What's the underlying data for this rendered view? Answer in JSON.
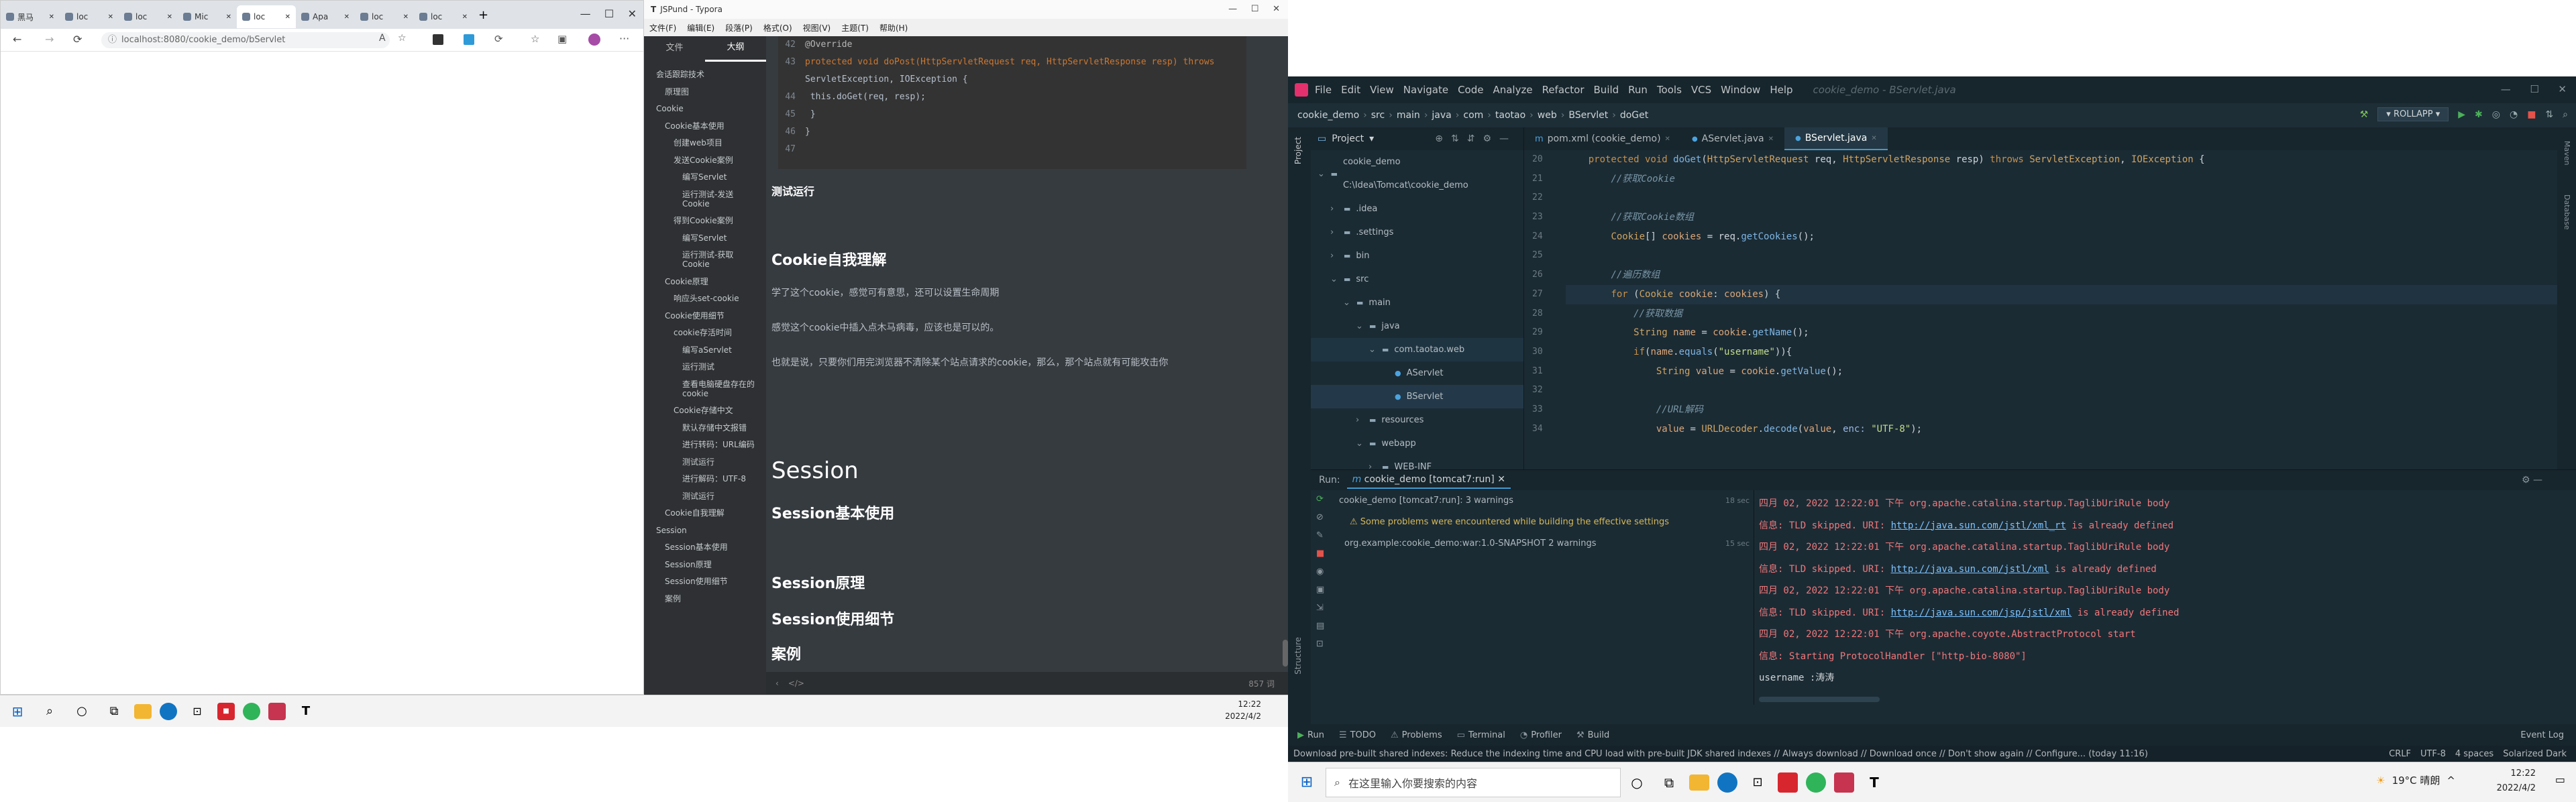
{
  "browser": {
    "tabs": [
      {
        "label": "黑马"
      },
      {
        "label": "loc"
      },
      {
        "label": "loc"
      },
      {
        "label": "Mic"
      },
      {
        "label": "loc"
      },
      {
        "label": "Apa"
      },
      {
        "label": "loc"
      },
      {
        "label": "loc"
      }
    ],
    "url": "localhost:8080/cookie_demo/bServlet"
  },
  "typora": {
    "title": "JSPund - Typora",
    "menu": [
      "文件(F)",
      "编辑(E)",
      "段落(P)",
      "格式(O)",
      "视图(V)",
      "主题(T)",
      "帮助(H)"
    ],
    "side_tabs": [
      "文件",
      "大纲"
    ],
    "outline": [
      {
        "label": "会话跟踪技术",
        "lv": 0
      },
      {
        "label": "原理图",
        "lv": 1
      },
      {
        "label": "Cookie",
        "lv": 0
      },
      {
        "label": "Cookie基本使用",
        "lv": 1
      },
      {
        "label": "创建web项目",
        "lv": 2
      },
      {
        "label": "发送Cookie案例",
        "lv": 2
      },
      {
        "label": "编写Servlet",
        "lv": 3
      },
      {
        "label": "运行测试-发送Cookie",
        "lv": 3
      },
      {
        "label": "得到Cookie案例",
        "lv": 2
      },
      {
        "label": "编写Servlet",
        "lv": 3
      },
      {
        "label": "运行测试-获取Cookie",
        "lv": 3
      },
      {
        "label": "Cookie原理",
        "lv": 1
      },
      {
        "label": "响应头set-cookie",
        "lv": 2
      },
      {
        "label": "Cookie使用细节",
        "lv": 1
      },
      {
        "label": "cookie存活时间",
        "lv": 2
      },
      {
        "label": "编写aServlet",
        "lv": 3
      },
      {
        "label": "运行测试",
        "lv": 3
      },
      {
        "label": "查看电脑硬盘存在的cookie",
        "lv": 3
      },
      {
        "label": "Cookie存储中文",
        "lv": 2
      },
      {
        "label": "默认存储中文报错",
        "lv": 3
      },
      {
        "label": "进行转码：URL编码",
        "lv": 3
      },
      {
        "label": "测试运行",
        "lv": 3
      },
      {
        "label": "进行解码：UTF-8",
        "lv": 3
      },
      {
        "label": "测试运行",
        "lv": 3
      },
      {
        "label": "Cookie自我理解",
        "lv": 1
      },
      {
        "label": "Session",
        "lv": 0
      },
      {
        "label": "Session基本使用",
        "lv": 1
      },
      {
        "label": "Session原理",
        "lv": 1
      },
      {
        "label": "Session使用细节",
        "lv": 1
      },
      {
        "label": "案例",
        "lv": 1
      }
    ],
    "code": {
      "lines": [
        {
          "n": "42",
          "t": "@Override",
          "cls": "an"
        },
        {
          "n": "43",
          "t": "protected void doPost(HttpServletRequest req, HttpServletResponse resp) throws",
          "cls": "kw"
        },
        {
          "n": "",
          "t": "ServletException, IOException {",
          "cls": ""
        },
        {
          "n": "44",
          "t": "    this.doGet(req, resp);",
          "cls": ""
        },
        {
          "n": "45",
          "t": "  }",
          "cls": ""
        },
        {
          "n": "46",
          "t": "}",
          "cls": ""
        },
        {
          "n": "47",
          "t": "",
          "cls": ""
        }
      ]
    },
    "sections": {
      "test_run": "测试运行",
      "cookie_self": "Cookie自我理解",
      "p1": "学了这个cookie，感觉可有意思，还可以设置生命周期",
      "p2": "感觉这个cookie中插入点木马病毒，应该也是可以的。",
      "p3": "也就是说，只要你们用完浏览器不清除某个站点请求的cookie，那么，那个站点就有可能攻击你",
      "session": "Session",
      "s_basic": "Session基本使用",
      "s_principle": "Session原理",
      "s_detail": "Session使用细节",
      "case": "案例"
    },
    "status": {
      "left": "</>",
      "right": "857 词"
    }
  },
  "taskbar_left": {
    "time": "12:22",
    "date": "2022/4/2"
  },
  "idea": {
    "menu": [
      "File",
      "Edit",
      "View",
      "Navigate",
      "Code",
      "Analyze",
      "Refactor",
      "Build",
      "Run",
      "Tools",
      "VCS",
      "Window",
      "Help"
    ],
    "title": "cookie_demo - BServlet.java",
    "breadcrumb": [
      "cookie_demo",
      "src",
      "main",
      "java",
      "com",
      "taotao",
      "web",
      "BServlet",
      "doGet"
    ],
    "run_config": "ROLLAPP",
    "project_label": "Project",
    "tree": [
      {
        "label": "cookie_demo  C:\\Idea\\Tomcat\\cookie_demo",
        "d": 0
      },
      {
        "label": ".idea",
        "d": 1
      },
      {
        "label": ".settings",
        "d": 1
      },
      {
        "label": "bin",
        "d": 1
      },
      {
        "label": "src",
        "d": 1
      },
      {
        "label": "main",
        "d": 2
      },
      {
        "label": "java",
        "d": 3
      },
      {
        "label": "com.taotao.web",
        "d": 4
      },
      {
        "label": "AServlet",
        "d": 5
      },
      {
        "label": "BServlet",
        "d": 5
      },
      {
        "label": "resources",
        "d": 3
      },
      {
        "label": "webapp",
        "d": 3
      },
      {
        "label": "WEB-INF",
        "d": 4
      }
    ],
    "tabs": [
      {
        "label": "pom.xml (cookie_demo)"
      },
      {
        "label": "AServlet.java"
      },
      {
        "label": "BServlet.java"
      }
    ],
    "lines": [
      {
        "n": "20",
        "html": "    <span class=ikw>protected void</span> <span class=imt>doGet</span>(<span class=ity>HttpServletRequest</span> req, <span class=ity>HttpServletResponse</span> resp) <span class=ikw>throws</span> <span class=ity>ServletException</span>, <span class=ity>IOException</span> {"
      },
      {
        "n": "21",
        "html": "        <span class=icm>//获取Cookie</span>"
      },
      {
        "n": "22",
        "html": ""
      },
      {
        "n": "23",
        "html": "        <span class=icm>//获取Cookie数组</span>"
      },
      {
        "n": "24",
        "html": "        <span class=ity>Cookie</span>[] <span class=iva>cookies</span> = req.<span class=imt>getCookies</span>();"
      },
      {
        "n": "25",
        "html": ""
      },
      {
        "n": "26",
        "html": "        <span class=icm>//遍历数组</span>"
      },
      {
        "n": "27",
        "html": "        <span class=ikw>for</span> (<span class=ity>Cookie</span> <span class=iva>cookie</span>: <span class=iva>cookies</span>) {"
      },
      {
        "n": "28",
        "html": "            <span class=icm>//获取数据</span>"
      },
      {
        "n": "29",
        "html": "            <span class=ity>String</span> <span class=iva>name</span> = <span class=iva>cookie</span>.<span class=imt>getName</span>();"
      },
      {
        "n": "30",
        "html": "            <span class=ikw>if</span>(<span class=iva>name</span>.<span class=imt>equals</span>(<span class=ist>\"username\"</span>)){"
      },
      {
        "n": "31",
        "html": "                <span class=ity>String</span> <span class=iva>value</span> = <span class=iva>cookie</span>.<span class=imt>getValue</span>();"
      },
      {
        "n": "32",
        "html": ""
      },
      {
        "n": "33",
        "html": "                <span class=icm>//URL解码</span>"
      },
      {
        "n": "34",
        "html": "                <span class=iva>value</span> = <span class=ity>URLDecoder</span>.<span class=imt>decode</span>(<span class=iva>value</span>, <span class=ipa>enc:</span> <span class=ist>\"UTF-8\"</span>);"
      }
    ],
    "run": {
      "label": "Run:",
      "tab": "cookie_demo [tomcat7:run]",
      "tree": [
        {
          "t": "cookie_demo [tomcat7:run]:  3 warnings",
          "r": "18 sec"
        },
        {
          "t": "⚠ Some problems were encountered while building the effective settings",
          "r": ""
        },
        {
          "t": "org.example:cookie_demo:war:1.0-SNAPSHOT  2 warnings",
          "r": "15 sec"
        }
      ],
      "log": [
        {
          "c": "red",
          "t": "四月 02, 2022 12:22:01 下午 org.apache.catalina.startup.TaglibUriRule body"
        },
        {
          "c": "red",
          "t": "信息: TLD skipped. URI: ",
          "link": "http://java.sun.com/jstl/xml_rt",
          "tail": " is already defined"
        },
        {
          "c": "red",
          "t": "四月 02, 2022 12:22:01 下午 org.apache.catalina.startup.TaglibUriRule body"
        },
        {
          "c": "red",
          "t": "信息: TLD skipped. URI: ",
          "link": "http://java.sun.com/jstl/xml",
          "tail": " is already defined"
        },
        {
          "c": "red",
          "t": "四月 02, 2022 12:22:01 下午 org.apache.catalina.startup.TaglibUriRule body"
        },
        {
          "c": "red",
          "t": "信息: TLD skipped. URI: ",
          "link": "http://java.sun.com/jsp/jstl/xml",
          "tail": " is already defined"
        },
        {
          "c": "red",
          "t": "四月 02, 2022 12:22:01 下午 org.apache.coyote.AbstractProtocol start"
        },
        {
          "c": "red",
          "t": "信息: Starting ProtocolHandler [\"http-bio-8080\"]"
        },
        {
          "c": "",
          "t": "username :涛涛"
        }
      ]
    },
    "bottom_tabs": [
      "Run",
      "TODO",
      "Problems",
      "Terminal",
      "Profiler",
      "Build"
    ],
    "event_log": "Event Log",
    "status": "Download pre-built shared indexes: Reduce the indexing time and CPU load with pre-built JDK shared indexes // Always download // Download once // Don't show again // Configure... (today 11:16)",
    "status_right": [
      "CRLF",
      "UTF-8",
      "4 spaces",
      "Solarized Dark"
    ]
  },
  "taskbar_right": {
    "search": "在这里输入你要搜索的内容",
    "weather": "19°C  晴朗",
    "time": "12:22",
    "date": "2022/4/2"
  }
}
